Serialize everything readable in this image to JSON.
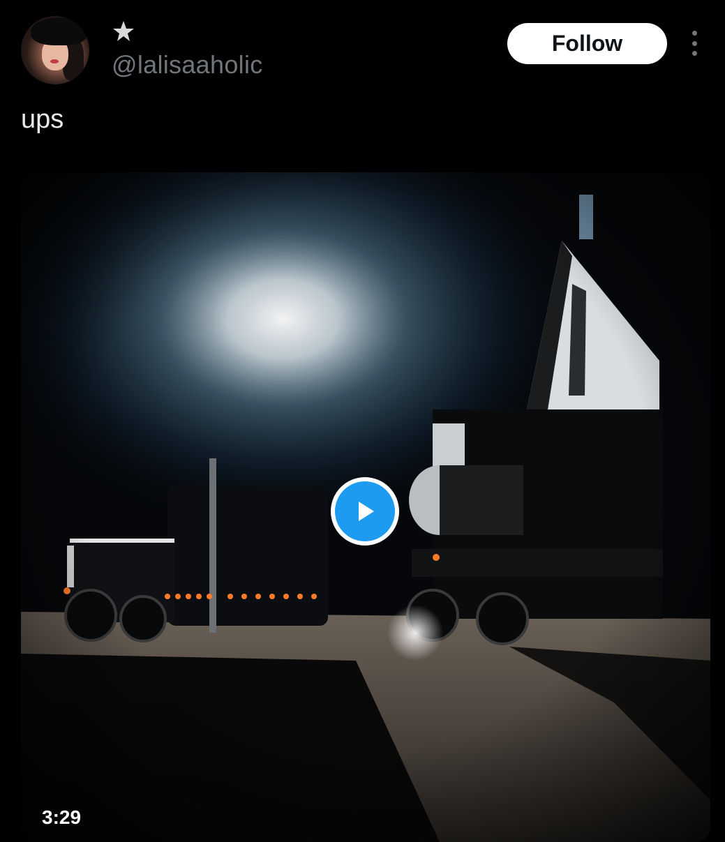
{
  "post": {
    "handle": "@lalisaaholic",
    "badge_icon": "star-icon",
    "follow_label": "Follow",
    "more_icon": "more-options-icon",
    "text": "ups"
  },
  "media": {
    "type": "video",
    "play_icon": "play-icon",
    "duration": "3:29"
  },
  "colors": {
    "background": "#000000",
    "handle": "#71767b",
    "text": "#e7e9ea",
    "play_accent": "#1d9bf0",
    "follow_bg": "#ffffff"
  }
}
